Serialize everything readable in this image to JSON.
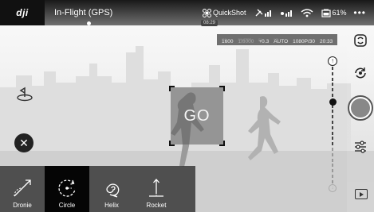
{
  "topbar": {
    "logo": "dji",
    "flight_status": "In-Flight (GPS)",
    "quickshot_label": "QuickShot",
    "battery_text": "61%",
    "recording_time": "08:29",
    "menu_icon": "more-dots-icon"
  },
  "camera_params": [
    {
      "label": "ISO",
      "value": "1600"
    },
    {
      "label": "SHUTTER",
      "value": "1/8000"
    },
    {
      "label": "EV",
      "value": "+0.3"
    },
    {
      "label": "WB",
      "value": "AUTO"
    },
    {
      "label": "",
      "value": "1080P/30"
    },
    {
      "label": "",
      "value": "20:33"
    }
  ],
  "go_button": {
    "label": "GO"
  },
  "gimbal": {
    "top_marker": "↑",
    "level": 0.29
  },
  "modes": [
    {
      "label": "Dronie",
      "icon": "dronie-icon",
      "active": false
    },
    {
      "label": "Circle",
      "icon": "circle-icon",
      "active": true
    },
    {
      "label": "Helix",
      "icon": "helix-icon",
      "active": false
    },
    {
      "label": "Rocket",
      "icon": "rocket-icon",
      "active": false
    }
  ],
  "colors": {
    "accent": "#ffffff",
    "active_mode_bg": "#050505",
    "modebar_bg": "#323232"
  }
}
